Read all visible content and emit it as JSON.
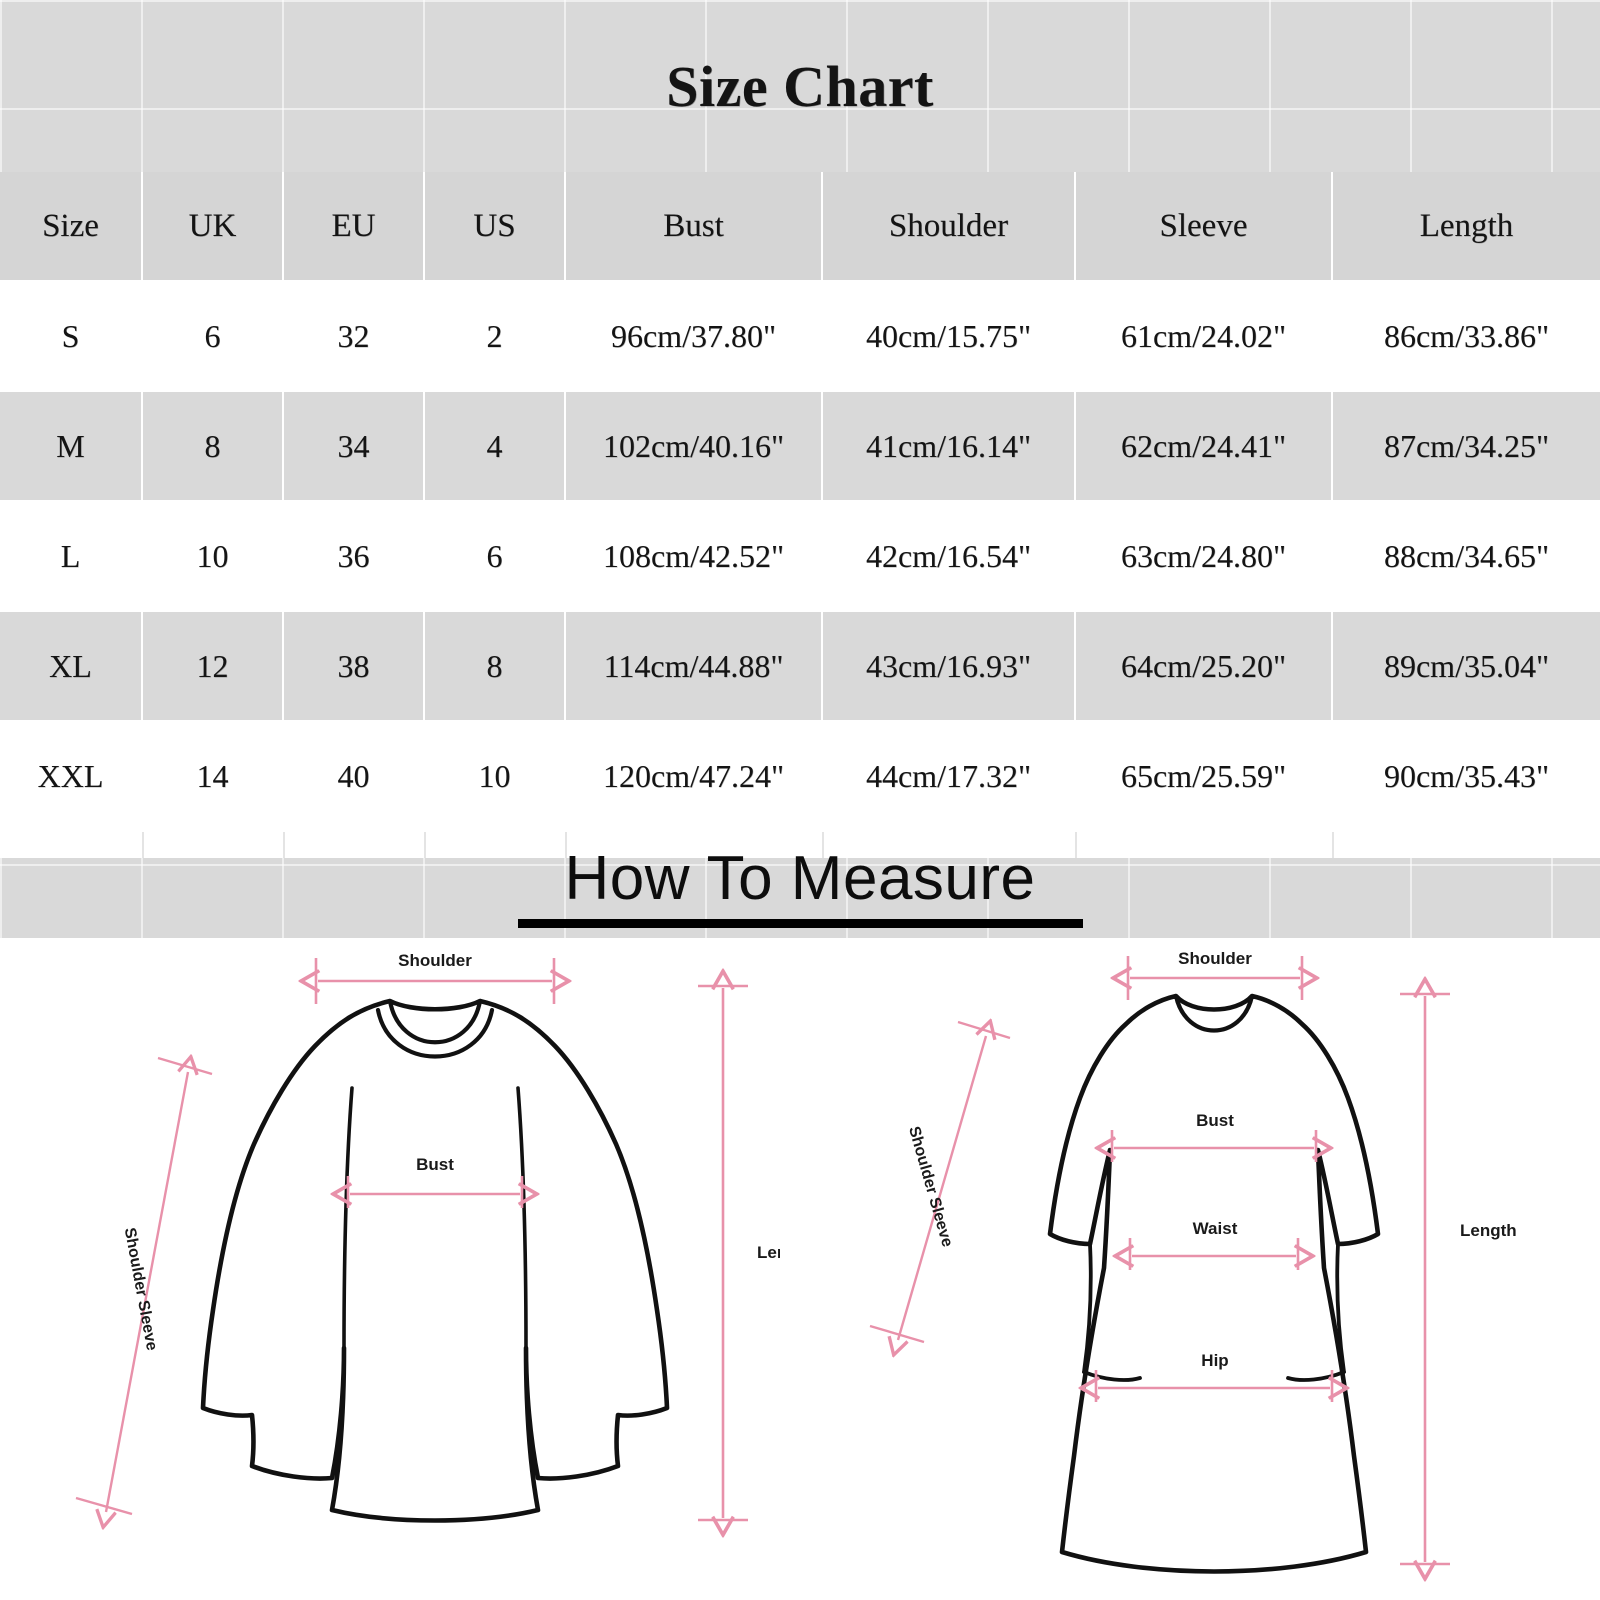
{
  "title": "Size Chart",
  "colors": {
    "page_background": "#d9d9d9",
    "header_row": "#d5d5d5",
    "row_odd": "#ffffff",
    "row_even": "#d9d9d9",
    "grid_line": "#ffffff",
    "text": "#141414",
    "arrow_pink": "#e891aa",
    "outline_black": "#000000"
  },
  "table": {
    "headers": [
      "Size",
      "UK",
      "EU",
      "US",
      "Bust",
      "Shoulder",
      "Sleeve",
      "Length"
    ],
    "rows": [
      {
        "size": "S",
        "uk": "6",
        "eu": "32",
        "us": "2",
        "bust": "96cm/37.80\"",
        "shoulder": "40cm/15.75\"",
        "sleeve": "61cm/24.02\"",
        "length": "86cm/33.86\""
      },
      {
        "size": "M",
        "uk": "8",
        "eu": "34",
        "us": "4",
        "bust": "102cm/40.16\"",
        "shoulder": "41cm/16.14\"",
        "sleeve": "62cm/24.41\"",
        "length": "87cm/34.25\""
      },
      {
        "size": "L",
        "uk": "10",
        "eu": "36",
        "us": "6",
        "bust": "108cm/42.52\"",
        "shoulder": "42cm/16.54\"",
        "sleeve": "63cm/24.80\"",
        "length": "88cm/34.65\""
      },
      {
        "size": "XL",
        "uk": "12",
        "eu": "38",
        "us": "8",
        "bust": "114cm/44.88\"",
        "shoulder": "43cm/16.93\"",
        "sleeve": "64cm/25.20\"",
        "length": "89cm/35.04\""
      },
      {
        "size": "XXL",
        "uk": "14",
        "eu": "40",
        "us": "10",
        "bust": "120cm/47.24\"",
        "shoulder": "44cm/17.32\"",
        "sleeve": "65cm/25.59\"",
        "length": "90cm/35.43\""
      }
    ]
  },
  "how_to_measure": {
    "heading": "How To Measure",
    "sweatshirt_diagram": {
      "name": "sweatshirt",
      "labels": {
        "shoulder": "Shoulder",
        "bust": "Bust",
        "shoulder_sleeve": "Shoulder Sleeve",
        "length": "Length"
      }
    },
    "dress_diagram": {
      "name": "dress",
      "labels": {
        "shoulder": "Shoulder",
        "bust": "Bust",
        "waist": "Waist",
        "hip": "Hip",
        "shoulder_sleeve": "Shoulder Sleeve",
        "length": "Length"
      }
    }
  }
}
